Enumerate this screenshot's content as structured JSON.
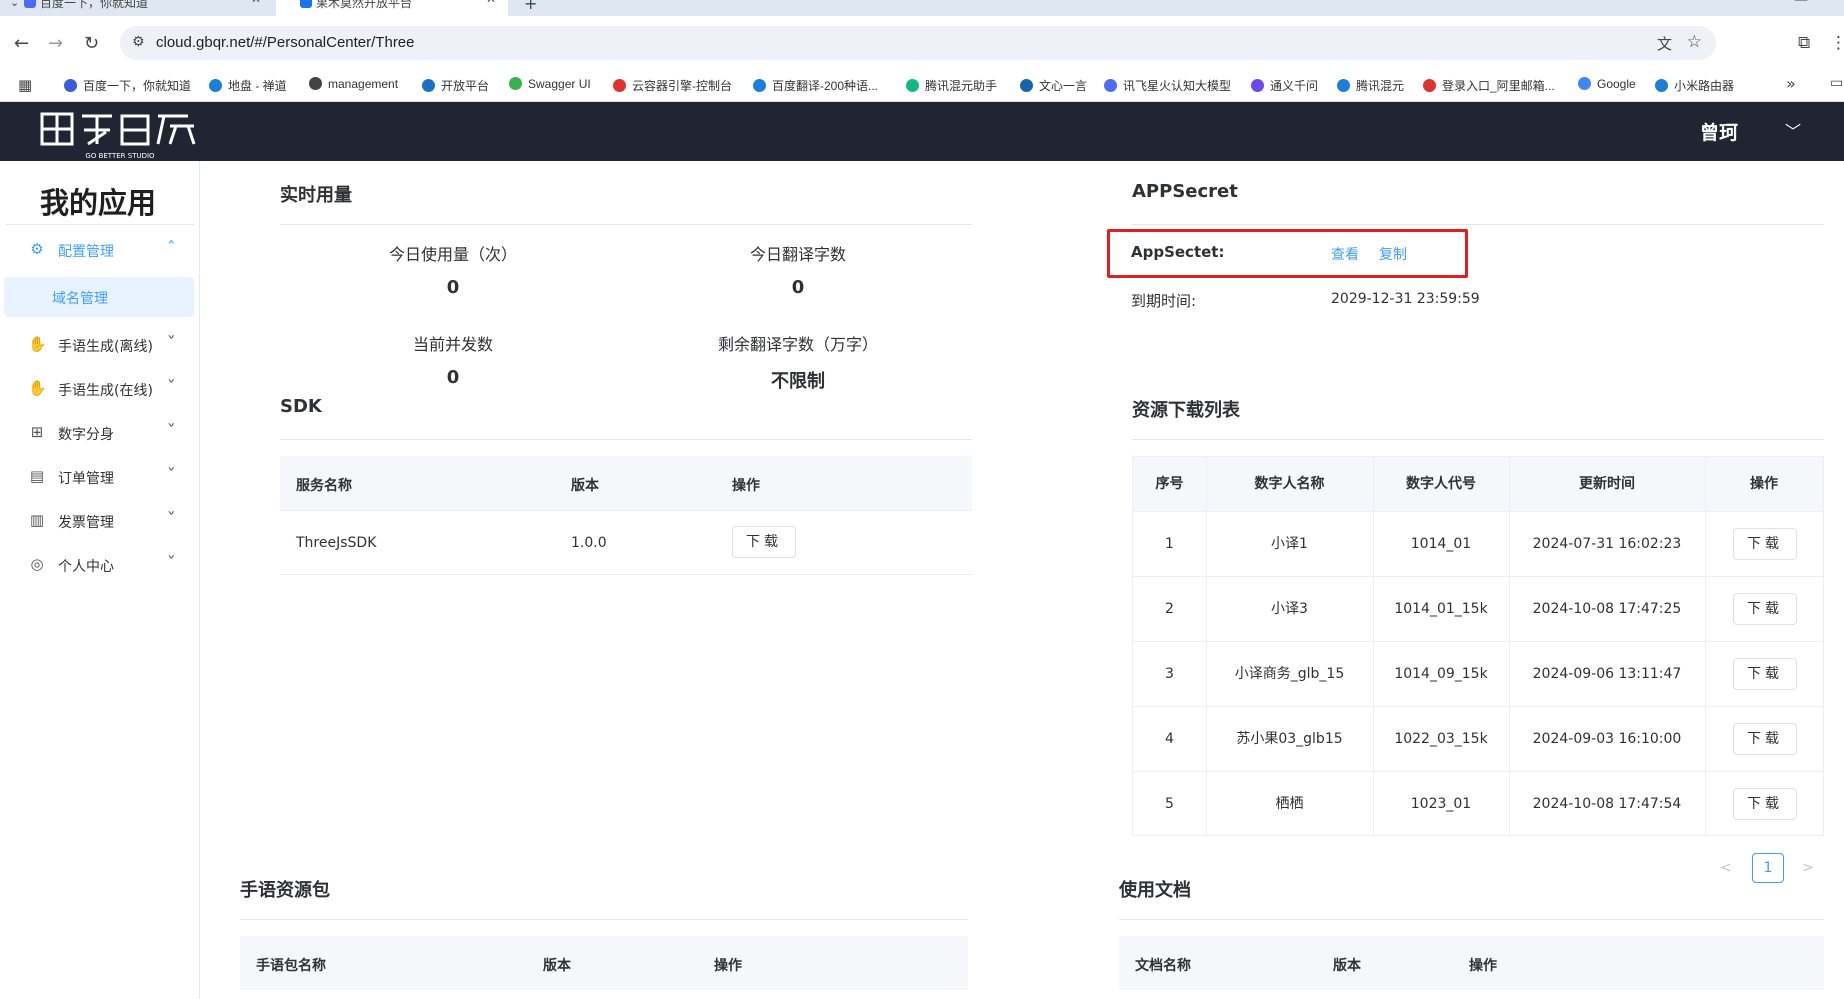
{
  "browser": {
    "tabs": [
      {
        "title": "百度一下，你就知道"
      },
      {
        "title": "果木莫然开放平台"
      }
    ],
    "url": "cloud.gbqr.net/#/PersonalCenter/Three",
    "bookmarks": [
      {
        "label": "百度一下，你就知道",
        "color": "#3b5bdb"
      },
      {
        "label": "地盘 - 禅道",
        "color": "#1c7ed6"
      },
      {
        "label": "management",
        "color": "#444444"
      },
      {
        "label": "开放平台",
        "color": "#1971c2"
      },
      {
        "label": "Swagger UI",
        "color": "#37b24d"
      },
      {
        "label": "云容器引擎-控制台",
        "color": "#e03131"
      },
      {
        "label": "百度翻译-200种语...",
        "color": "#1c7ed6"
      },
      {
        "label": "腾讯混元助手",
        "color": "#12b886"
      },
      {
        "label": "文心一言",
        "color": "#1864ab"
      },
      {
        "label": "讯飞星火认知大模型",
        "color": "#4c6ef5"
      },
      {
        "label": "通义千问",
        "color": "#7048e8"
      },
      {
        "label": "腾讯混元",
        "color": "#1c7ed6"
      },
      {
        "label": "登录入口_阿里邮箱...",
        "color": "#e03131"
      },
      {
        "label": "Google",
        "color": "#4285f4"
      },
      {
        "label": "小米路由器",
        "color": "#1c7ed6"
      }
    ]
  },
  "header": {
    "username": "曾珂",
    "logo_text": "GO BETTER STUDIO"
  },
  "sidebar": {
    "title": "我的应用",
    "menu": [
      {
        "label": "配置管理",
        "icon": "config-icon"
      },
      {
        "label": "域名管理"
      },
      {
        "label": "手语生成(离线)",
        "icon": "sign-offline-icon"
      },
      {
        "label": "手语生成(在线)",
        "icon": "sign-online-icon"
      },
      {
        "label": "数字分身",
        "icon": "digital-twin-icon"
      },
      {
        "label": "订单管理",
        "icon": "order-icon"
      },
      {
        "label": "发票管理",
        "icon": "invoice-icon"
      },
      {
        "label": "个人中心",
        "icon": "user-icon"
      }
    ]
  },
  "usage": {
    "title": "实时用量",
    "today_usage_label": "今日使用量（次）",
    "today_usage_value": "0",
    "today_chars_label": "今日翻译字数",
    "today_chars_value": "0",
    "concurrency_label": "当前并发数",
    "concurrency_value": "0",
    "remaining_label": "剩余翻译字数（万字）",
    "remaining_value": "不限制"
  },
  "appsecret": {
    "title": "APPSecret",
    "label": "AppSectet:",
    "view": "查看",
    "copy": "复制",
    "expire_label": "到期时间:",
    "expire_value": "2029-12-31 23:59:59"
  },
  "sdk": {
    "title": "SDK",
    "headers": [
      "服务名称",
      "版本",
      "操作"
    ],
    "rows": [
      {
        "name": "ThreeJsSDK",
        "version": "1.0.0",
        "action": "下载"
      }
    ]
  },
  "resources": {
    "title": "资源下载列表",
    "headers": [
      "序号",
      "数字人名称",
      "数字人代号",
      "更新时间",
      "操作"
    ],
    "rows": [
      {
        "no": "1",
        "name": "小译1",
        "code": "1014_01",
        "time": "2024-07-31 16:02:23",
        "action": "下载"
      },
      {
        "no": "2",
        "name": "小译3",
        "code": "1014_01_15k",
        "time": "2024-10-08 17:47:25",
        "action": "下载"
      },
      {
        "no": "3",
        "name": "小译商务_glb_15",
        "code": "1014_09_15k",
        "time": "2024-09-06 13:11:47",
        "action": "下载"
      },
      {
        "no": "4",
        "name": "苏小果03_glb15",
        "code": "1022_03_15k",
        "time": "2024-09-03 16:10:00",
        "action": "下载"
      },
      {
        "no": "5",
        "name": "栖栖",
        "code": "1023_01",
        "time": "2024-10-08 17:47:54",
        "action": "下载"
      }
    ],
    "page": "1"
  },
  "sign_pack": {
    "title": "手语资源包",
    "headers": [
      "手语包名称",
      "版本",
      "操作"
    ]
  },
  "docs": {
    "title": "使用文档",
    "headers": [
      "文档名称",
      "版本",
      "操作"
    ]
  }
}
